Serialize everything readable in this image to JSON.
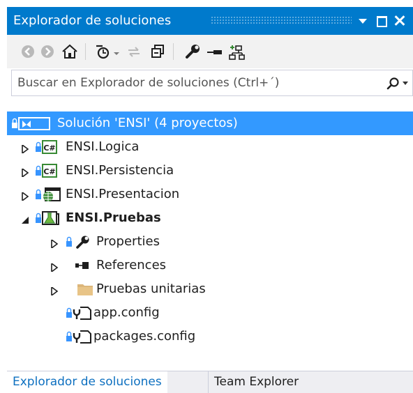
{
  "title_bar": {
    "title": "Explorador de soluciones"
  },
  "search": {
    "placeholder": "Buscar en Explorador de soluciones (Ctrl+´)"
  },
  "toolbar": {
    "icons": [
      "back-icon",
      "forward-icon",
      "home-icon",
      "pending-changes-icon",
      "sync-icon",
      "collapse-all-icon",
      "properties-icon",
      "show-all-files-icon",
      "view-class-diagram-icon"
    ]
  },
  "tree": {
    "solution": {
      "label": "Solución 'ENSI'  (4 proyectos)"
    },
    "projects": [
      {
        "label": "ENSI.Logica",
        "type": "csharp"
      },
      {
        "label": "ENSI.Persistencia",
        "type": "csharp"
      },
      {
        "label": "ENSI.Presentacion",
        "type": "web"
      },
      {
        "label": "ENSI.Pruebas",
        "type": "test"
      }
    ],
    "children": [
      {
        "label": "Properties"
      },
      {
        "label": "References"
      },
      {
        "label": "Pruebas unitarias"
      },
      {
        "label": "app.config"
      },
      {
        "label": "packages.config"
      }
    ]
  },
  "tabs": [
    {
      "label": "Explorador de soluciones"
    },
    {
      "label": "Team Explorer"
    }
  ],
  "colors": {
    "accent": "#007acc",
    "selection": "#3399ff",
    "active_tab_text": "#0e70c0"
  }
}
